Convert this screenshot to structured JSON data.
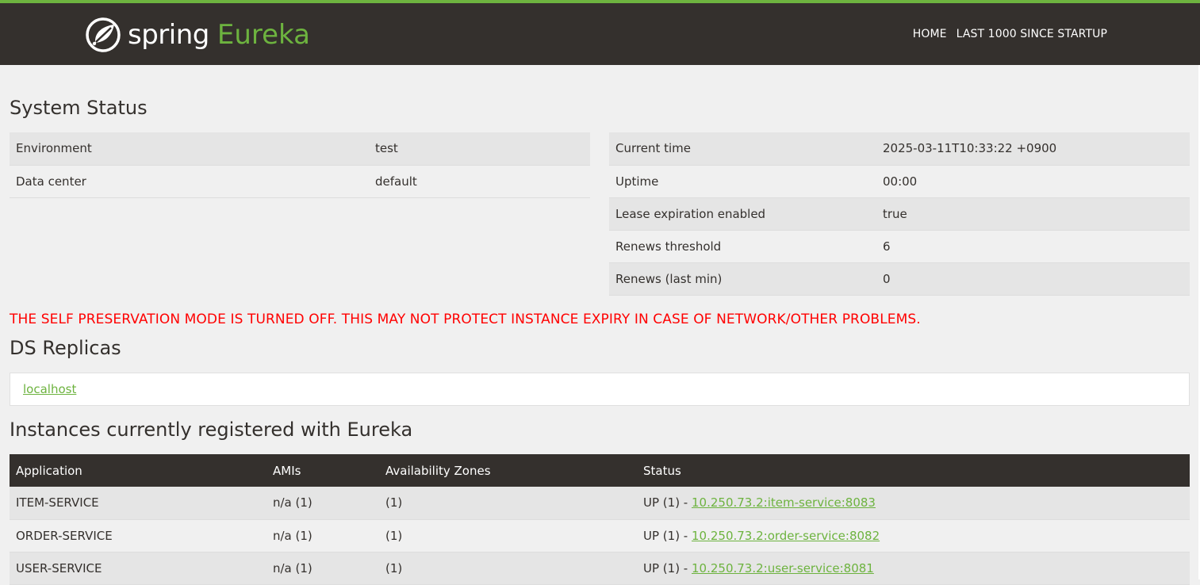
{
  "header": {
    "brand_spring": "spring",
    "brand_eureka": "Eureka",
    "nav": [
      {
        "label": "HOME"
      },
      {
        "label": "LAST 1000 SINCE STARTUP"
      }
    ],
    "colors": {
      "bar": "#34302d",
      "accent": "#6db33f",
      "warning": "#ff0000"
    }
  },
  "system_status": {
    "title": "System Status",
    "left": [
      {
        "key": "Environment",
        "value": "test"
      },
      {
        "key": "Data center",
        "value": "default"
      }
    ],
    "right": [
      {
        "key": "Current time",
        "value": "2025-03-11T10:33:22 +0900"
      },
      {
        "key": "Uptime",
        "value": "00:00"
      },
      {
        "key": "Lease expiration enabled",
        "value": "true"
      },
      {
        "key": "Renews threshold",
        "value": "6"
      },
      {
        "key": "Renews (last min)",
        "value": "0"
      }
    ]
  },
  "warning": "THE SELF PRESERVATION MODE IS TURNED OFF. THIS MAY NOT PROTECT INSTANCE EXPIRY IN CASE OF NETWORK/OTHER PROBLEMS.",
  "replicas": {
    "title": "DS Replicas",
    "link": "localhost"
  },
  "instances": {
    "title": "Instances currently registered with Eureka",
    "columns": [
      "Application",
      "AMIs",
      "Availability Zones",
      "Status"
    ],
    "rows": [
      {
        "app": "ITEM-SERVICE",
        "amis": "n/a (1)",
        "zones": "(1)",
        "status_prefix": "UP (1) - ",
        "status_link": "10.250.73.2:item-service:8083"
      },
      {
        "app": "ORDER-SERVICE",
        "amis": "n/a (1)",
        "zones": "(1)",
        "status_prefix": "UP (1) - ",
        "status_link": "10.250.73.2:order-service:8082"
      },
      {
        "app": "USER-SERVICE",
        "amis": "n/a (1)",
        "zones": "(1)",
        "status_prefix": "UP (1) - ",
        "status_link": "10.250.73.2:user-service:8081"
      }
    ]
  }
}
